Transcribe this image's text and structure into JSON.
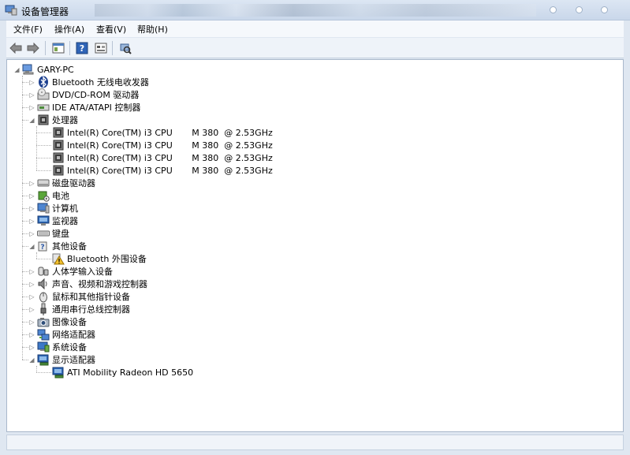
{
  "window": {
    "title": "设备管理器",
    "icon": "device-manager-icon"
  },
  "menu": [
    {
      "label": "文件(F)"
    },
    {
      "label": "操作(A)"
    },
    {
      "label": "查看(V)"
    },
    {
      "label": "帮助(H)"
    }
  ],
  "toolbar": {
    "buttons": [
      "back-arrow-icon",
      "forward-arrow-icon",
      "properties-icon",
      "help-icon",
      "show-hidden-icon",
      "scan-hardware-icon"
    ]
  },
  "tree": {
    "root": "GARY-PC",
    "categories": [
      {
        "label": "Bluetooth 无线电收发器",
        "icon": "bluetooth-icon",
        "expanded": false
      },
      {
        "label": "DVD/CD-ROM 驱动器",
        "icon": "dvd-drive-icon",
        "expanded": false
      },
      {
        "label": "IDE ATA/ATAPI 控制器",
        "icon": "ide-controller-icon",
        "expanded": false
      },
      {
        "label": "处理器",
        "icon": "processor-icon",
        "expanded": true,
        "children": [
          {
            "label": "Intel(R) Core(TM) i3 CPU       M 380  @ 2.53GHz"
          },
          {
            "label": "Intel(R) Core(TM) i3 CPU       M 380  @ 2.53GHz"
          },
          {
            "label": "Intel(R) Core(TM) i3 CPU       M 380  @ 2.53GHz"
          },
          {
            "label": "Intel(R) Core(TM) i3 CPU       M 380  @ 2.53GHz"
          }
        ]
      },
      {
        "label": "磁盘驱动器",
        "icon": "disk-drive-icon",
        "expanded": false
      },
      {
        "label": "电池",
        "icon": "battery-icon",
        "expanded": false
      },
      {
        "label": "计算机",
        "icon": "computer-icon",
        "expanded": false
      },
      {
        "label": "监视器",
        "icon": "monitor-icon",
        "expanded": false
      },
      {
        "label": "键盘",
        "icon": "keyboard-icon",
        "expanded": false
      },
      {
        "label": "其他设备",
        "icon": "other-devices-icon",
        "expanded": true,
        "children": [
          {
            "label": "Bluetooth 外围设备",
            "warning": true
          }
        ]
      },
      {
        "label": "人体学输入设备",
        "icon": "hid-icon",
        "expanded": false
      },
      {
        "label": "声音、视频和游戏控制器",
        "icon": "sound-icon",
        "expanded": false
      },
      {
        "label": "鼠标和其他指针设备",
        "icon": "mouse-icon",
        "expanded": false
      },
      {
        "label": "通用串行总线控制器",
        "icon": "usb-icon",
        "expanded": false
      },
      {
        "label": "图像设备",
        "icon": "imaging-icon",
        "expanded": false
      },
      {
        "label": "网络适配器",
        "icon": "network-adapter-icon",
        "expanded": false
      },
      {
        "label": "系统设备",
        "icon": "system-devices-icon",
        "expanded": false
      },
      {
        "label": "显示适配器",
        "icon": "display-adapter-icon",
        "expanded": true,
        "children": [
          {
            "label": "ATI Mobility Radeon HD 5650"
          }
        ]
      }
    ]
  },
  "status": {
    "text": ""
  },
  "colors": {
    "accent": "#2b63b3",
    "warning": "#f2c12e"
  }
}
